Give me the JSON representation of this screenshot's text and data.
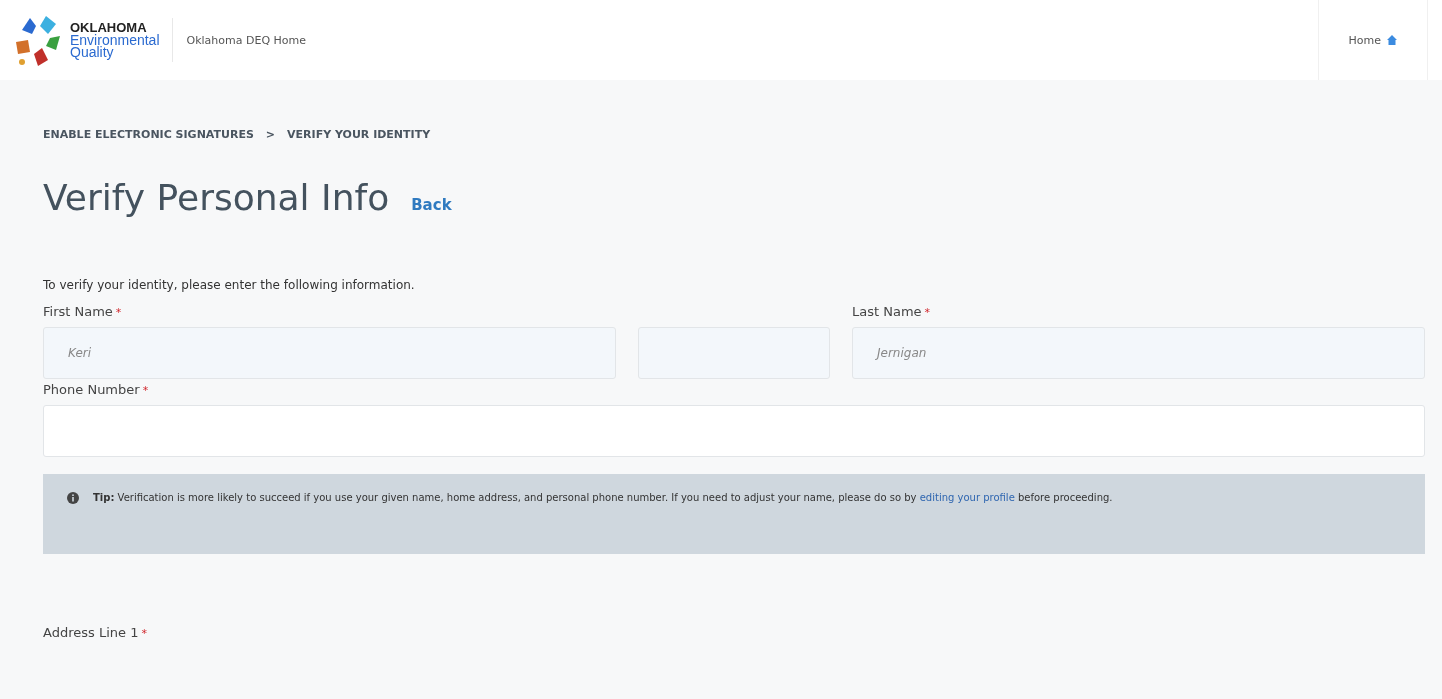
{
  "header": {
    "logo_lines": [
      "OKLAHOMA",
      "Environmental",
      "Quality"
    ],
    "site_link": "Oklahoma DEQ Home",
    "home_link": "Home"
  },
  "breadcrumb": {
    "items": [
      "ENABLE ELECTRONIC SIGNATURES",
      "VERIFY YOUR IDENTITY"
    ],
    "separator": ">"
  },
  "title": "Verify Personal Info",
  "back_link": "Back",
  "intro": "To verify your identity, please enter the following information.",
  "name_fields": [
    {
      "label": "First Name",
      "required_mark": "*",
      "value": "Keri",
      "disabled": true
    },
    {
      "disabled": true
    },
    {
      "label": "Last Name",
      "required_mark": "*",
      "value": "Jernigan",
      "disabled": true
    }
  ],
  "phone": {
    "label": "Phone Number",
    "required_mark": "*",
    "disabled": false
  },
  "tip": {
    "text": "**Tip:** Verification is more likely to succeed if you use your given name, home address, and personal phone number. If you need to adjust your name, please do so by",
    "link": "editing your profile",
    "after": "before proceeding."
  },
  "address": {
    "label": "Address Line 1",
    "required_mark": "*"
  }
}
